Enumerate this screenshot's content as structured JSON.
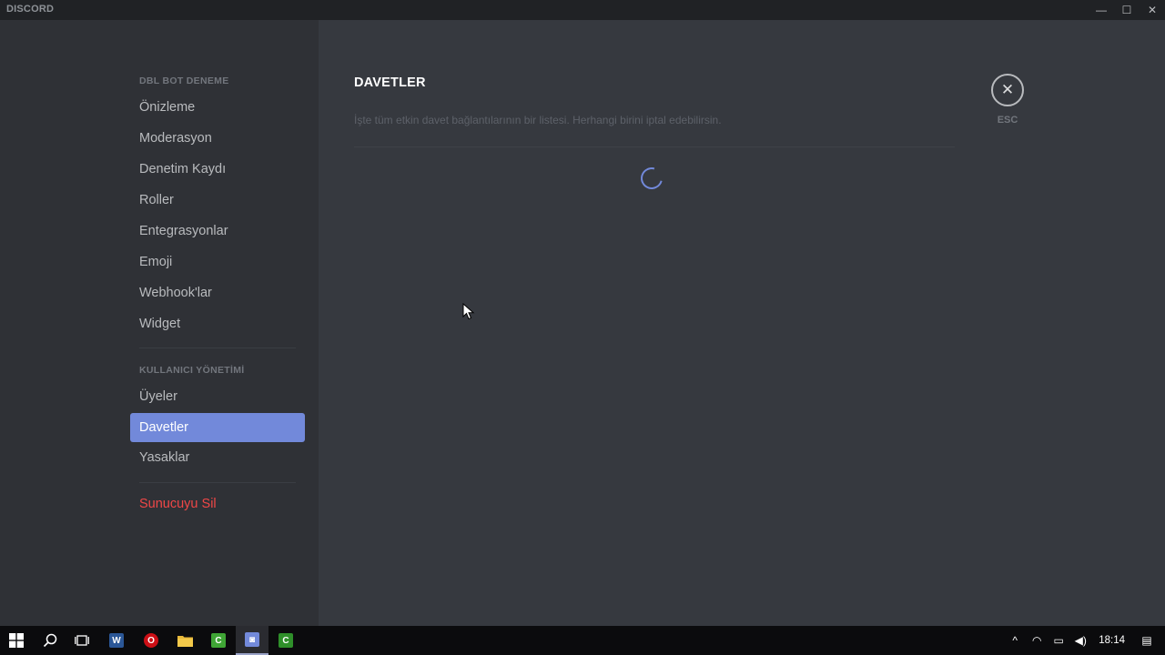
{
  "window": {
    "brand": "DISCORD",
    "minimize_glyph": "—",
    "maximize_glyph": "☐",
    "close_glyph": "✕"
  },
  "sidebar": {
    "server_header": "DBL BOT DENEME",
    "server_items": [
      {
        "label": "Önizleme"
      },
      {
        "label": "Moderasyon"
      },
      {
        "label": "Denetim Kaydı"
      },
      {
        "label": "Roller"
      },
      {
        "label": "Entegrasyonlar"
      },
      {
        "label": "Emoji"
      },
      {
        "label": "Webhook'lar"
      },
      {
        "label": "Widget"
      }
    ],
    "user_header": "KULLANICI YÖNETİMİ",
    "user_items": [
      {
        "label": "Üyeler"
      },
      {
        "label": "Davetler"
      },
      {
        "label": "Yasaklar"
      }
    ],
    "active_item": "Davetler",
    "delete_label": "Sunucuyu Sil"
  },
  "main": {
    "title": "DAVETLER",
    "description": "İşte tüm etkin davet bağlantılarının bir listesi. Herhangi birini iptal edebilirsin.",
    "close_glyph": "✕",
    "close_label": "ESC"
  },
  "taskbar": {
    "apps": [
      {
        "name": "start"
      },
      {
        "name": "search"
      },
      {
        "name": "task-view"
      },
      {
        "name": "word",
        "glyph": "W",
        "color": "#2b5797"
      },
      {
        "name": "opera",
        "glyph": "O",
        "color": "#cc0f16"
      },
      {
        "name": "file-explorer",
        "color": "#e8b93a"
      },
      {
        "name": "camtasia",
        "glyph": "C",
        "color": "#3fa535"
      },
      {
        "name": "discord",
        "glyph": "◙",
        "color": "#7289da"
      },
      {
        "name": "camtasia-recorder",
        "glyph": "C",
        "color": "#2f8f2a"
      }
    ],
    "tray": {
      "chevron_glyph": "^",
      "network_glyph": "◠",
      "battery_glyph": "▭",
      "volume_glyph": "◀)",
      "notification_glyph": "▤"
    },
    "clock": "18:14"
  },
  "colors": {
    "accent": "#7289da",
    "danger": "#f04747",
    "sidebar_bg": "#2f3136",
    "content_bg": "#36393f"
  }
}
